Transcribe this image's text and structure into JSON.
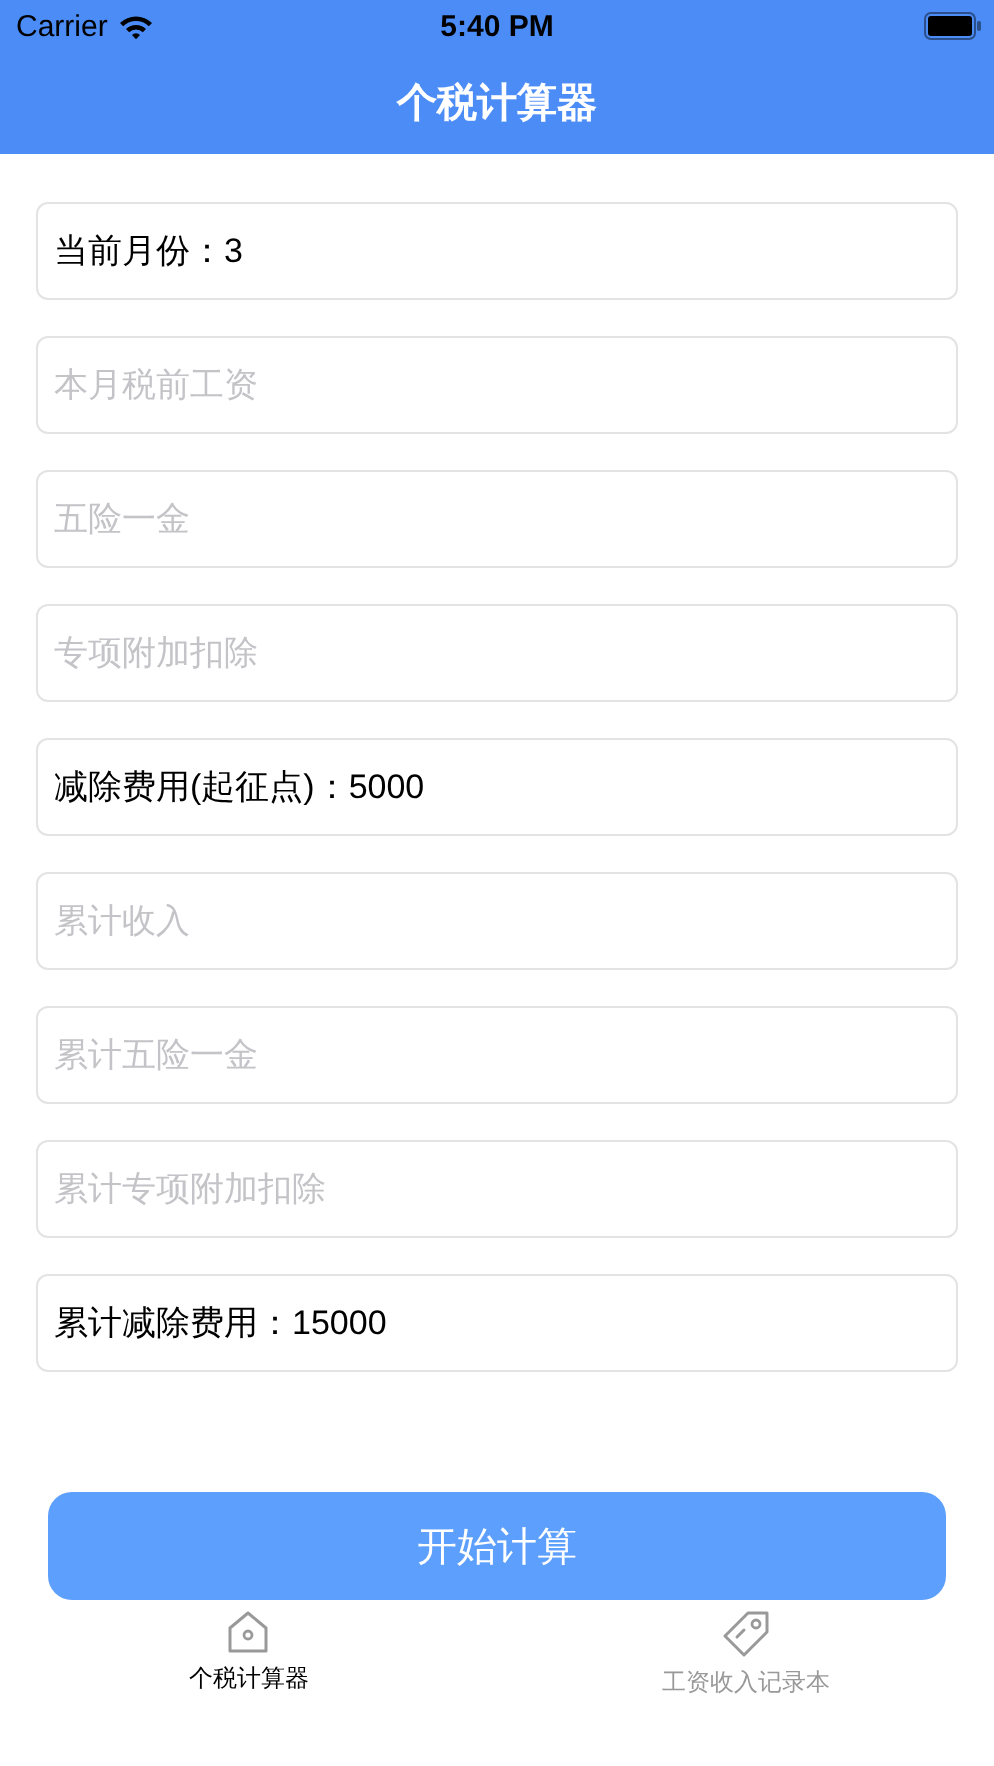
{
  "status_bar": {
    "carrier": "Carrier",
    "time": "5:40 PM"
  },
  "nav_bar": {
    "title": "个税计算器"
  },
  "fields": [
    {
      "value": "当前月份：3"
    },
    {
      "placeholder": "本月税前工资"
    },
    {
      "placeholder": "五险一金"
    },
    {
      "placeholder": "专项附加扣除"
    },
    {
      "value": "减除费用(起征点)：5000"
    },
    {
      "placeholder": "累计收入"
    },
    {
      "placeholder": "累计五险一金"
    },
    {
      "placeholder": "累计专项附加扣除"
    },
    {
      "value": "累计减除费用：15000"
    }
  ],
  "button": {
    "label": "开始计算"
  },
  "tab_bar": [
    {
      "label": "个税计算器",
      "kind": "home",
      "selected": true
    },
    {
      "label": "工资收入记录本",
      "kind": "tag",
      "selected": false
    }
  ]
}
